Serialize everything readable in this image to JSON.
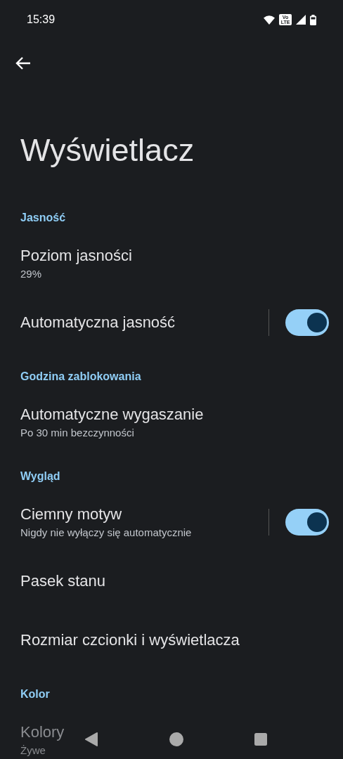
{
  "status_bar": {
    "time": "15:39",
    "network_badge": "Vo LTE"
  },
  "title": "Wyświetlacz",
  "sections": [
    {
      "header": "Jasność",
      "items": [
        {
          "kind": "text",
          "title": "Poziom jasności",
          "subtitle": "29%"
        },
        {
          "kind": "toggle",
          "title": "Automatyczna jasność",
          "on": true
        }
      ]
    },
    {
      "header": "Godzina zablokowania",
      "items": [
        {
          "kind": "text",
          "title": "Automatyczne wygaszanie",
          "subtitle": "Po 30 min bezczynności"
        }
      ]
    },
    {
      "header": "Wygląd",
      "items": [
        {
          "kind": "toggle",
          "title": "Ciemny motyw",
          "subtitle": "Nigdy nie wyłączy się automatycznie",
          "on": true
        },
        {
          "kind": "text",
          "title": "Pasek stanu"
        },
        {
          "kind": "text",
          "title": "Rozmiar czcionki i wyświetlacza"
        }
      ]
    },
    {
      "header": "Kolor",
      "items": [
        {
          "kind": "text",
          "title": "Kolory",
          "subtitle": "Żywe",
          "disabled": true
        }
      ]
    }
  ]
}
